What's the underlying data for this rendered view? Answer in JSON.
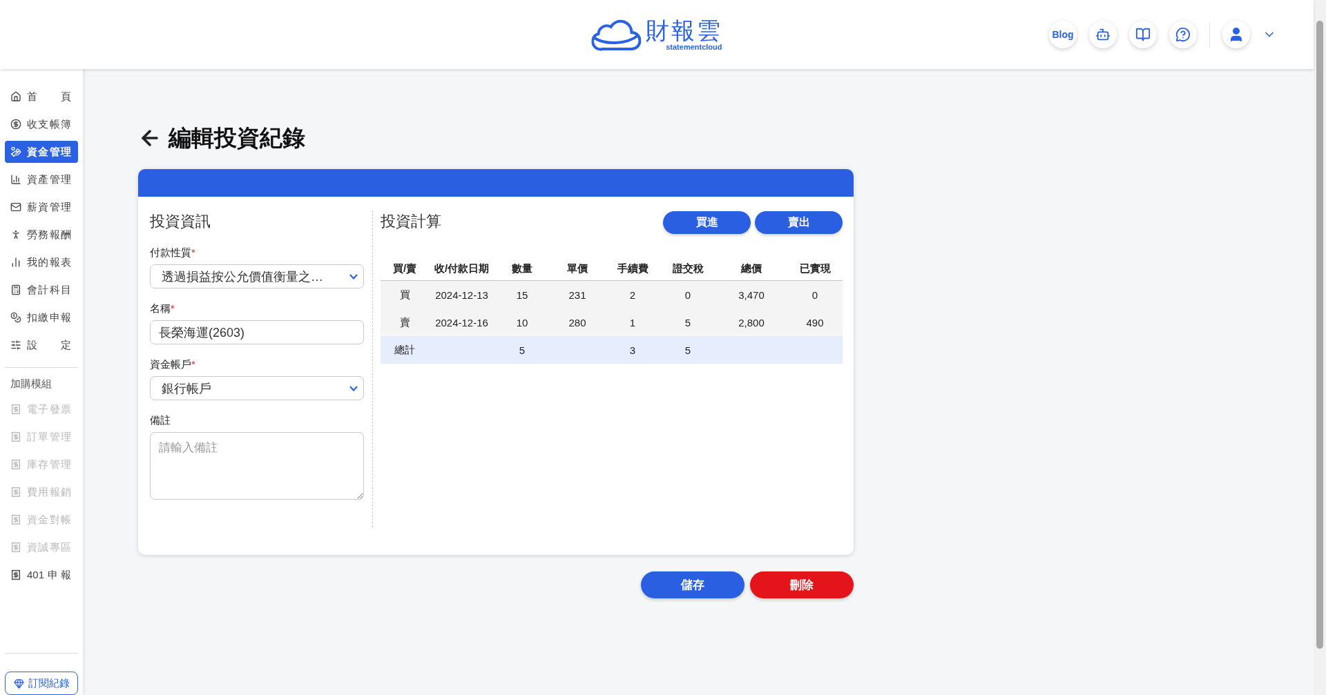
{
  "header": {
    "logo_text": "財報雲",
    "logo_subtext": "statementcloud",
    "blog_label": "Blog"
  },
  "sidebar": {
    "items": [
      {
        "label": "首頁",
        "selected": false
      },
      {
        "label": "收支帳簿",
        "selected": false
      },
      {
        "label": "資金管理",
        "selected": true
      },
      {
        "label": "資產管理",
        "selected": false
      },
      {
        "label": "薪資管理",
        "selected": false
      },
      {
        "label": "勞務報酬",
        "selected": false
      },
      {
        "label": "我的報表",
        "selected": false
      },
      {
        "label": "會計科目",
        "selected": false
      },
      {
        "label": "扣繳申報",
        "selected": false
      },
      {
        "label": "設定",
        "selected": false
      }
    ],
    "addon_heading": "加購模組",
    "addon_items": [
      {
        "label": "電子發票",
        "disabled": true
      },
      {
        "label": "訂單管理",
        "disabled": true
      },
      {
        "label": "庫存管理",
        "disabled": true
      },
      {
        "label": "費用報銷",
        "disabled": true
      },
      {
        "label": "資金對帳",
        "disabled": true
      },
      {
        "label": "資誠專區",
        "disabled": true
      },
      {
        "label": "401申報",
        "disabled": false
      }
    ],
    "subscription_button": "訂閱紀錄"
  },
  "page": {
    "title": "編輯投資紀錄"
  },
  "info": {
    "heading": "投資資訊",
    "fields": [
      {
        "kind": "select",
        "label": "付款性質",
        "required_mark": "*",
        "value": "透過損益按公允價值衡量之…"
      },
      {
        "kind": "input",
        "label": "名稱",
        "required_mark": "*",
        "value": "長榮海運(2603)"
      },
      {
        "kind": "select",
        "label": "資金帳戶",
        "required_mark": "*",
        "value": "銀行帳戶"
      },
      {
        "kind": "textarea",
        "label": "備註",
        "placeholder": "請輸入備註"
      }
    ]
  },
  "calc": {
    "heading": "投資計算",
    "buttons": [
      "買進",
      "賣出"
    ],
    "table": {
      "columns": [
        "買/賣",
        "收/付款日期",
        "數量",
        "單價",
        "手續費",
        "證交稅",
        "總價",
        "已實現"
      ],
      "rows": [
        {
          "kind": "entry",
          "cells": [
            "買",
            "2024-12-13",
            "15",
            "231",
            "2",
            "0",
            "3,470",
            "0"
          ]
        },
        {
          "kind": "entry",
          "cells": [
            "賣",
            "2024-12-16",
            "10",
            "280",
            "1",
            "5",
            "2,800",
            "490"
          ]
        },
        {
          "kind": "total",
          "cells": [
            "總計",
            null,
            "5",
            null,
            "3",
            "5",
            null,
            null
          ]
        }
      ]
    }
  },
  "actions": {
    "save": "儲存",
    "delete": "刪除"
  }
}
